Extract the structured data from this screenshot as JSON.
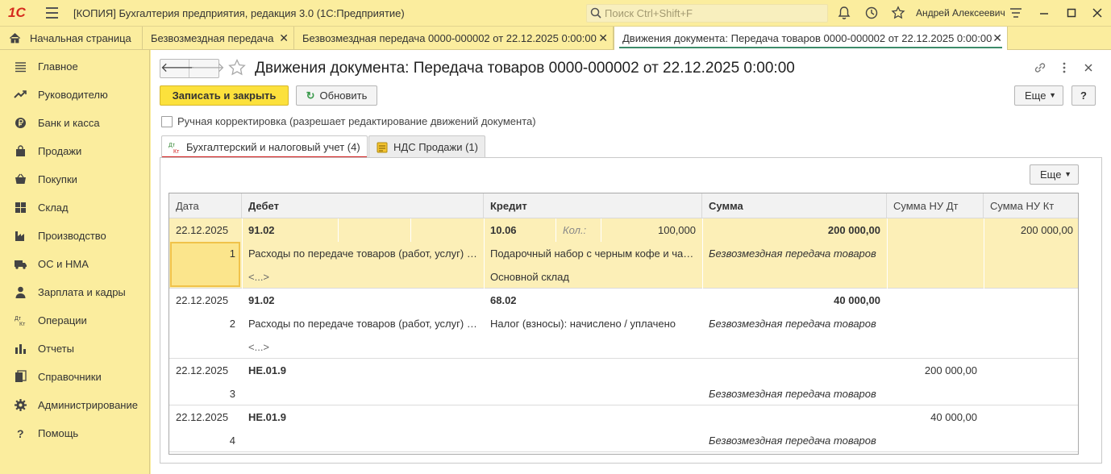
{
  "titlebar": {
    "logo": "1С",
    "title": "[КОПИЯ] Бухгалтерия предприятия, редакция 3.0  (1С:Предприятие)",
    "search_placeholder": "Поиск Ctrl+Shift+F",
    "user": "Андрей Алексеевич",
    "icons": [
      "bell-icon",
      "history-icon",
      "star-icon",
      "settings-icon",
      "minimize-icon",
      "maximize-icon",
      "close-icon"
    ]
  },
  "tabs": [
    {
      "label": "Начальная страница",
      "icon": "home-icon"
    },
    {
      "label": "Безвозмездная передача",
      "close": "✕"
    },
    {
      "label": "Безвозмездная передача 0000-000002 от 22.12.2025 0:00:00",
      "close": "✕"
    },
    {
      "label": "Движения документа: Передача товаров 0000-000002 от 22.12.2025 0:00:00",
      "close": "✕",
      "active": true
    }
  ],
  "sidebar": {
    "items": [
      {
        "label": "Главное",
        "icon": "menu-list-icon"
      },
      {
        "label": "Руководителю",
        "icon": "trend-icon"
      },
      {
        "label": "Банк и касса",
        "icon": "ruble-coin-icon"
      },
      {
        "label": "Продажи",
        "icon": "shopping-bag-icon"
      },
      {
        "label": "Покупки",
        "icon": "basket-icon"
      },
      {
        "label": "Склад",
        "icon": "warehouse-icon"
      },
      {
        "label": "Производство",
        "icon": "factory-icon"
      },
      {
        "label": "ОС и НМА",
        "icon": "truck-icon"
      },
      {
        "label": "Зарплата и кадры",
        "icon": "person-icon"
      },
      {
        "label": "Операции",
        "icon": "dt-kt-icon"
      },
      {
        "label": "Отчеты",
        "icon": "bar-chart-icon"
      },
      {
        "label": "Справочники",
        "icon": "books-icon"
      },
      {
        "label": "Администрирование",
        "icon": "gear-icon"
      },
      {
        "label": "Помощь",
        "icon": "question-icon"
      }
    ]
  },
  "doc": {
    "title": "Движения документа: Передача товаров 0000-000002 от 22.12.2025 0:00:00",
    "save_close": "Записать и закрыть",
    "refresh": "Обновить",
    "more": "Еще",
    "help": "?",
    "manual_label": "Ручная корректировка (разрешает редактирование движений документа)",
    "dt_label": "Дт",
    "kt_label": "Кт"
  },
  "panel_tabs": [
    {
      "label": "Бухгалтерский и налоговый учет (4)",
      "active": true
    },
    {
      "label": "НДС Продажи (1)",
      "active": false
    }
  ],
  "grid": {
    "more": "Еще",
    "columns": [
      "Дата",
      "Дебет",
      "Кредит",
      "Сумма",
      "Сумма НУ Дт",
      "Сумма НУ Кт"
    ],
    "rows": [
      {
        "date": "22.12.2025",
        "num": "1",
        "debit": "91.02",
        "debit_sub": "Расходы по передаче товаров (работ, услуг) безвозмездно",
        "debit_sub2": "<...>",
        "credit": "10.06",
        "credit_qty_label": "Кол.:",
        "credit_qty": "100,000",
        "credit_sub": "Подарочный набор с черным кофе и чаем",
        "credit_sub2": "Основной склад",
        "sum": "200 000,00",
        "content": "Безвозмездная передача товаров",
        "nu_dt": "",
        "nu_kt": "200 000,00"
      },
      {
        "date": "22.12.2025",
        "num": "2",
        "debit": "91.02",
        "debit_sub": "Расходы по передаче товаров (работ, услуг) безвозмездно",
        "debit_sub2": "<...>",
        "credit": "68.02",
        "credit_sub": "Налог (взносы): начислено / уплачено",
        "sum": "40 000,00",
        "content": "Безвозмездная передача товаров",
        "nu_dt": "",
        "nu_kt": ""
      },
      {
        "date": "22.12.2025",
        "num": "3",
        "debit": "НЕ.01.9",
        "sum": "",
        "content": "Безвозмездная передача товаров",
        "nu_dt": "200 000,00",
        "nu_kt": ""
      },
      {
        "date": "22.12.2025",
        "num": "4",
        "debit": "НЕ.01.9",
        "sum": "",
        "content": "Безвозмездная передача товаров",
        "nu_dt": "40 000,00",
        "nu_kt": ""
      }
    ]
  }
}
